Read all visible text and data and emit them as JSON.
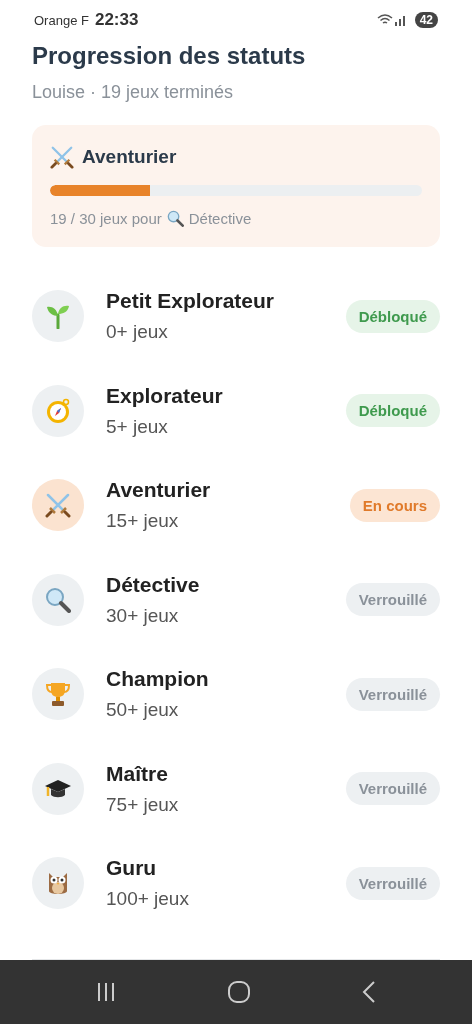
{
  "status_bar": {
    "carrier": "Orange F",
    "time": "22:33",
    "battery": "42"
  },
  "title": "Progression des statuts",
  "subtitle": "Louise · 19 jeux terminés",
  "current_card": {
    "name": "Aventurier",
    "level": 0.27,
    "progress_text": "19 / 30 jeux pour",
    "next_name": "Détective"
  },
  "levels": [
    {
      "name": "Petit Explorateur",
      "requirement": "0+ jeux",
      "kind": "unlocked",
      "badge": "Débloqué"
    },
    {
      "name": "Explorateur",
      "requirement": "5+ jeux",
      "kind": "unlocked",
      "badge": "Débloqué"
    },
    {
      "name": "Aventurier",
      "requirement": "15+ jeux",
      "kind": "current",
      "badge": "En cours"
    },
    {
      "name": "Détective",
      "requirement": "30+ jeux",
      "kind": "locked",
      "badge": "Verrouillé"
    },
    {
      "name": "Champion",
      "requirement": "50+ jeux",
      "kind": "locked",
      "badge": "Verrouillé"
    },
    {
      "name": "Maître",
      "requirement": "75+ jeux",
      "kind": "locked",
      "badge": "Verrouillé"
    },
    {
      "name": "Guru",
      "requirement": "100+ jeux",
      "kind": "locked",
      "badge": "Verrouillé"
    }
  ]
}
